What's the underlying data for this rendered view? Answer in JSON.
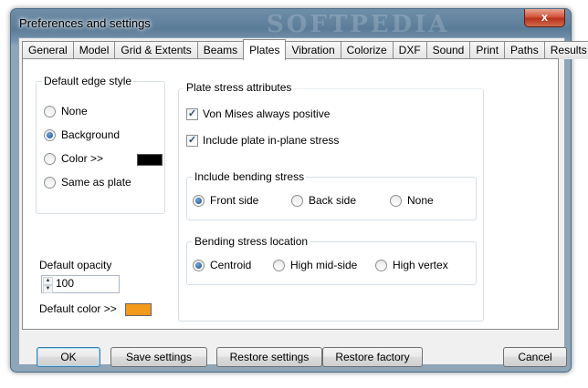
{
  "window": {
    "title": "Preferences and settings",
    "watermark": "SOFTPEDIA",
    "close_label": "x"
  },
  "tabs": [
    "General",
    "Model",
    "Grid & Extents",
    "Beams",
    "Plates",
    "Vibration",
    "Colorize",
    "DXF",
    "Sound",
    "Print",
    "Paths",
    "Results"
  ],
  "active_tab": "Plates",
  "edge_style": {
    "label": "Default edge style",
    "options": [
      "None",
      "Background",
      "Color >>",
      "Same as plate"
    ],
    "selected": "Background",
    "color_swatch": "#000000"
  },
  "opacity": {
    "label": "Default opacity",
    "value": "100"
  },
  "default_color": {
    "label": "Default color >>",
    "swatch": "#f39a1c"
  },
  "plate_stress": {
    "label": "Plate stress attributes",
    "von_mises": {
      "label": "Von Mises always positive",
      "checked": true
    },
    "in_plane": {
      "label": "Include plate in-plane stress",
      "checked": true
    }
  },
  "bending": {
    "label": "Include bending stress",
    "options": [
      "Front side",
      "Back side",
      "None"
    ],
    "selected": "Front side"
  },
  "bending_location": {
    "label": "Bending stress location",
    "options": [
      "Centroid",
      "High mid-side",
      "High vertex"
    ],
    "selected": "Centroid"
  },
  "buttons": {
    "ok": "OK",
    "save": "Save settings",
    "restore": "Restore settings",
    "factory": "Restore factory",
    "cancel": "Cancel"
  }
}
